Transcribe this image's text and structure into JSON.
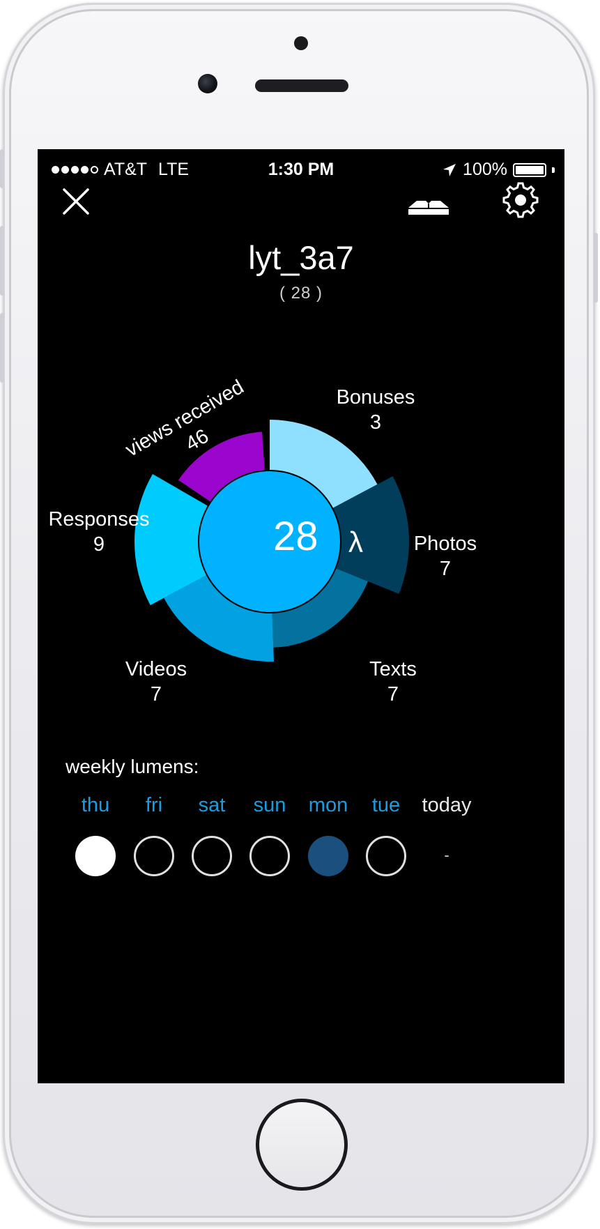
{
  "status_bar": {
    "carrier": "AT&T",
    "network": "LTE",
    "time": "1:30 PM",
    "battery": "100%",
    "signal_bars": 4,
    "signal_max": 5
  },
  "toolbar": {
    "close_icon": "close-icon",
    "book_icon": "open-book-icon",
    "settings_icon": "gear-icon"
  },
  "header": {
    "title": "lyt_3a7",
    "subtitle": "( 28 )"
  },
  "chart_data": {
    "type": "pie",
    "center_value": "28",
    "center_unit": "λ",
    "segments": [
      {
        "label": "Bonuses",
        "value": "3",
        "color": "#8fdfff"
      },
      {
        "label": "Photos",
        "value": "7",
        "color": "#003e5b"
      },
      {
        "label": "Texts",
        "value": "7",
        "color": "#03729e"
      },
      {
        "label": "Videos",
        "value": "7",
        "color": "#02a1e2"
      },
      {
        "label": "Responses",
        "value": "9",
        "color": "#00cbfd"
      },
      {
        "label": "views received",
        "value": "46",
        "color": "#9a06cd"
      }
    ],
    "center_color": "#00b2ff"
  },
  "weekly": {
    "title": "weekly lumens:",
    "days": [
      {
        "label": "thu",
        "state": "full"
      },
      {
        "label": "fri",
        "state": "empty"
      },
      {
        "label": "sat",
        "state": "empty"
      },
      {
        "label": "sun",
        "state": "empty"
      },
      {
        "label": "mon",
        "state": "mid"
      },
      {
        "label": "tue",
        "state": "empty"
      }
    ],
    "today_label": "today",
    "today_value": "-",
    "day_color": "#1a9de0"
  }
}
